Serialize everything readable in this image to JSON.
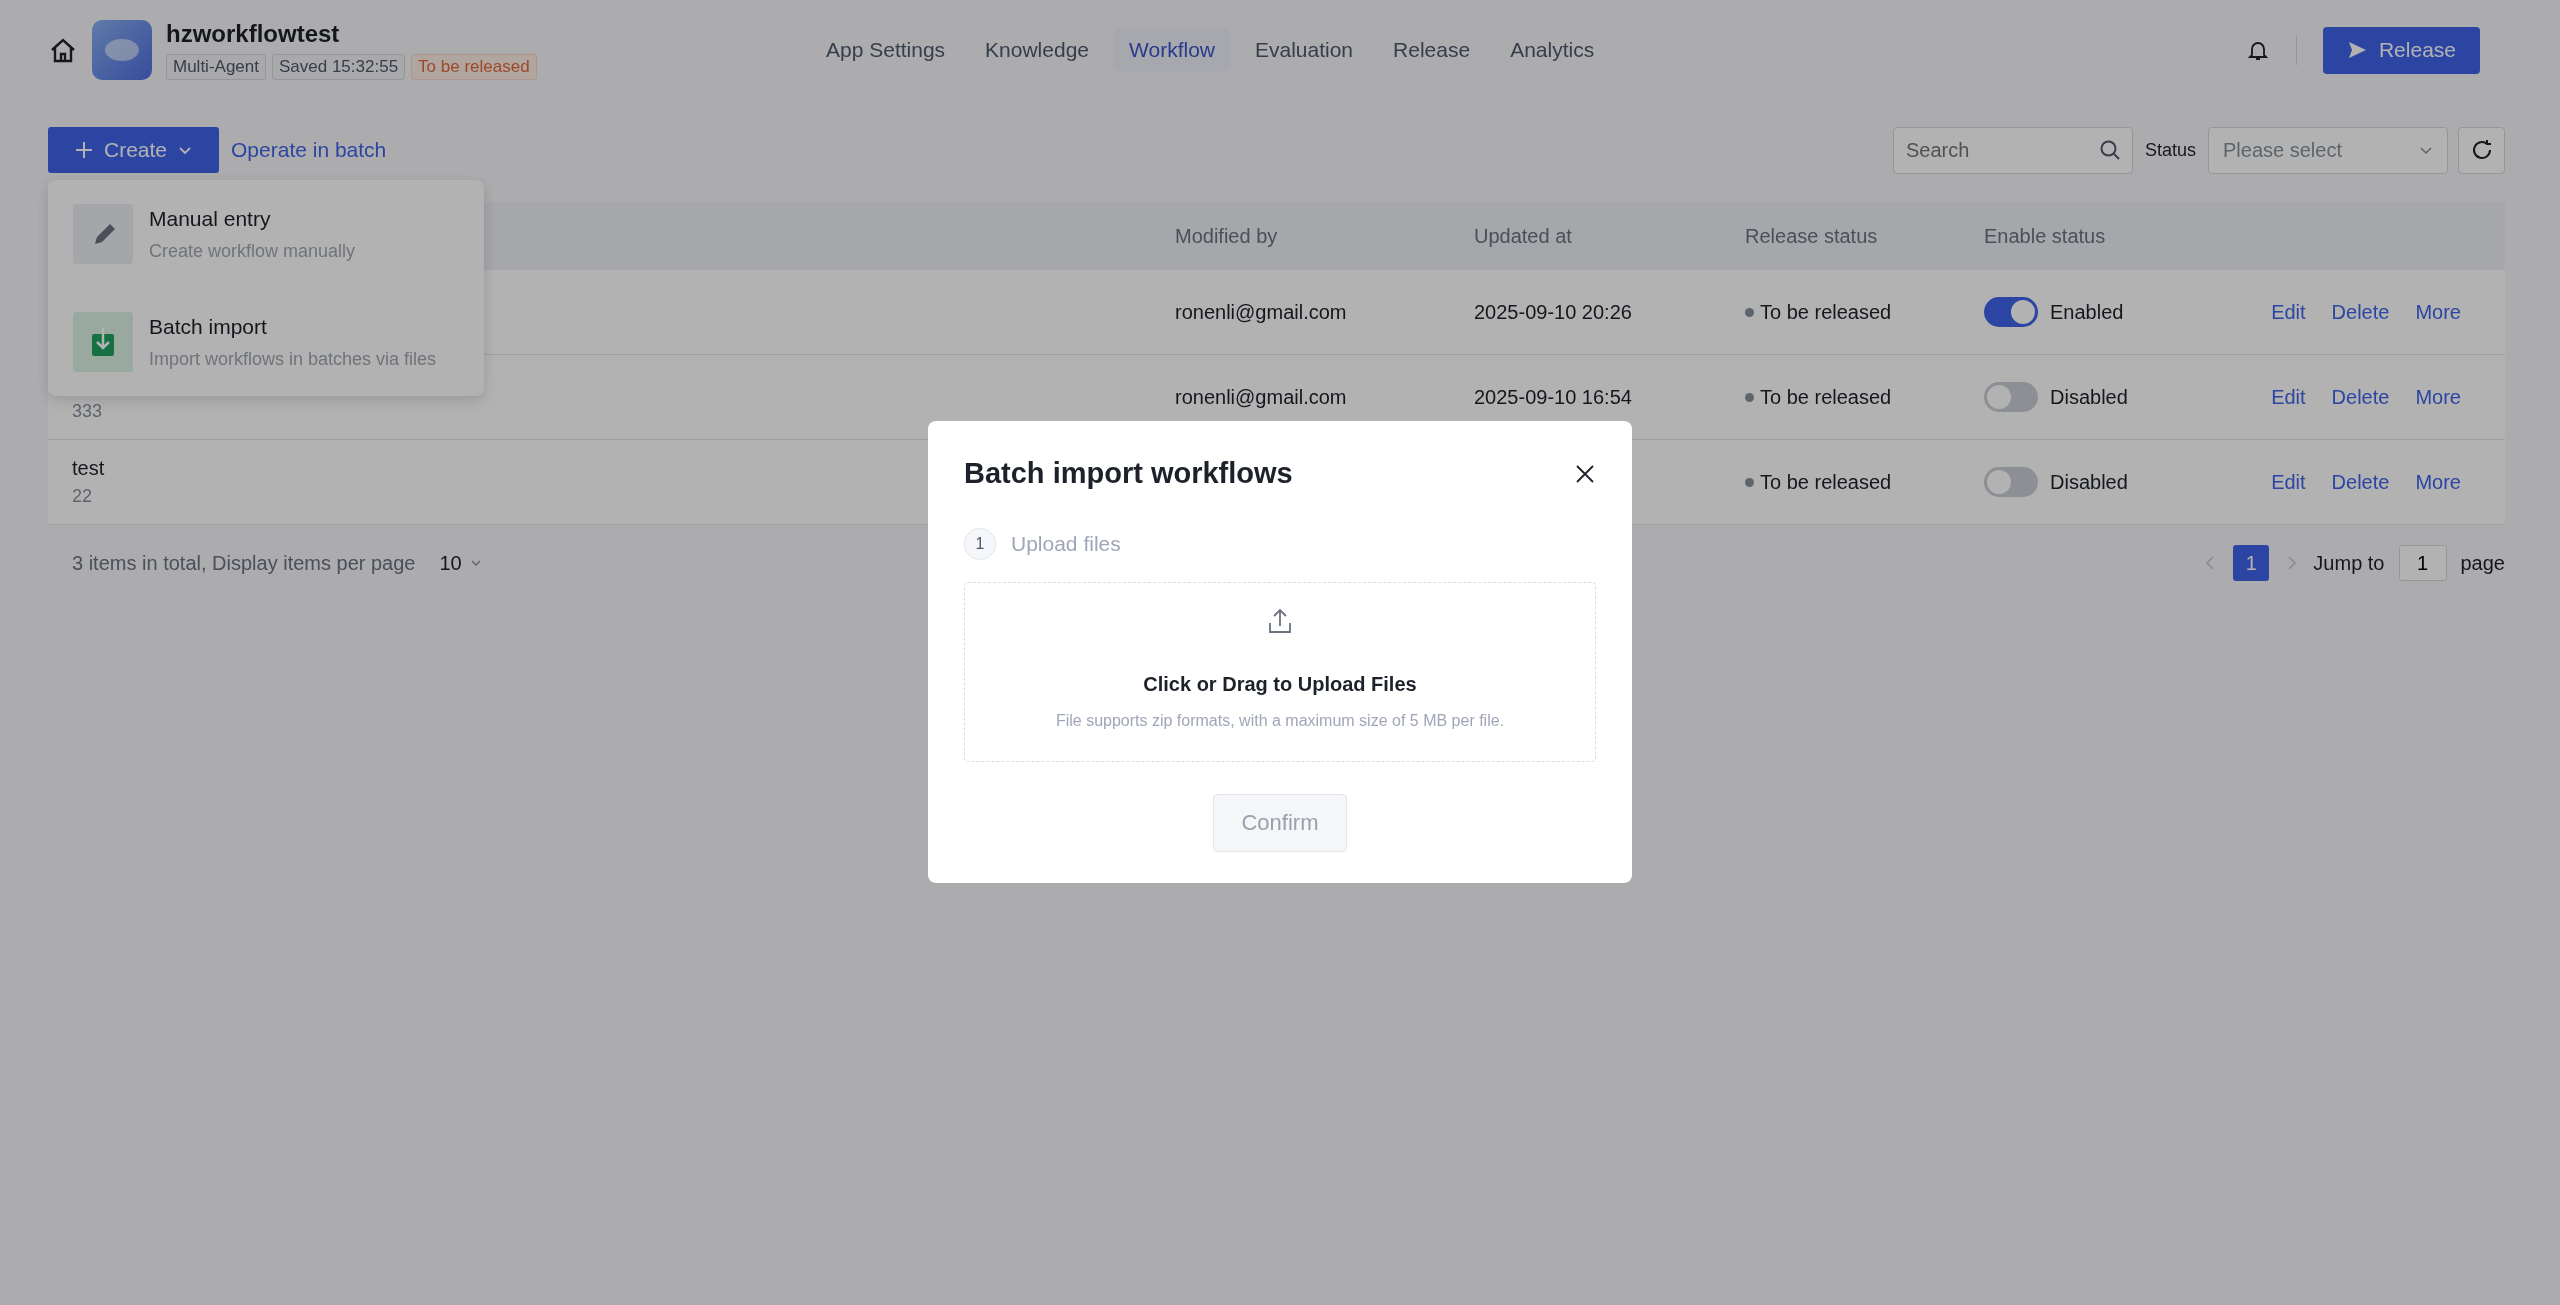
{
  "header": {
    "app_name": "hzworkflowtest",
    "tags": [
      {
        "label": "Multi-Agent",
        "kind": "neutral"
      },
      {
        "label": "Saved 15:32:55",
        "kind": "neutral"
      },
      {
        "label": "To be released",
        "kind": "warning"
      }
    ],
    "tabs": [
      {
        "label": "App Settings",
        "selected": false
      },
      {
        "label": "Knowledge",
        "selected": false
      },
      {
        "label": "Workflow",
        "selected": true
      },
      {
        "label": "Evaluation",
        "selected": false
      },
      {
        "label": "Release",
        "selected": false
      },
      {
        "label": "Analytics",
        "selected": false
      }
    ],
    "release_button": "Release"
  },
  "toolbar": {
    "create_button": "Create",
    "batch_link": "Operate in batch",
    "search": {
      "placeholder": "Search"
    },
    "status_label": "Status",
    "status_select": {
      "placeholder": "Please select"
    }
  },
  "create_menu": [
    {
      "kind": "manual",
      "title": "Manual entry",
      "description": "Create workflow manually"
    },
    {
      "kind": "import",
      "title": "Batch import",
      "description": "Import workflows in batches via files"
    }
  ],
  "table": {
    "columns": [
      "Modified by",
      "Updated at",
      "Release status",
      "Enable status"
    ],
    "rows": [
      {
        "modified_by": "ronenli@gmail.com",
        "updated_at": "2025-09-10 20:26",
        "release_status": "To be released",
        "enabled": true,
        "enable_label": "Enabled",
        "actions": [
          "Edit",
          "Delete",
          "More"
        ]
      },
      {
        "description": "333",
        "modified_by": "ronenli@gmail.com",
        "updated_at": "2025-09-10 16:54",
        "release_status": "To be released",
        "enabled": false,
        "enable_label": "Disabled",
        "actions": [
          "Edit",
          "Delete",
          "More"
        ]
      },
      {
        "name": "test",
        "description": "22",
        "release_status": "To be released",
        "enabled": false,
        "enable_label": "Disabled",
        "actions": [
          "Edit",
          "Delete",
          "More"
        ]
      }
    ]
  },
  "pagination": {
    "summary": "3 items in total, Display items per page",
    "page_size": "10",
    "pages": [
      {
        "label": "1",
        "selected": true
      }
    ],
    "jump_label": "Jump to",
    "jump_value": "1",
    "page_label": "page"
  },
  "modal": {
    "title": "Batch import workflows",
    "step": {
      "number": "1",
      "label": "Upload files"
    },
    "upload": {
      "title": "Click or Drag to Upload Files",
      "hint": "File supports zip formats, with a maximum size of 5 MB per file."
    },
    "confirm_button": "Confirm",
    "confirm_disabled": true
  }
}
